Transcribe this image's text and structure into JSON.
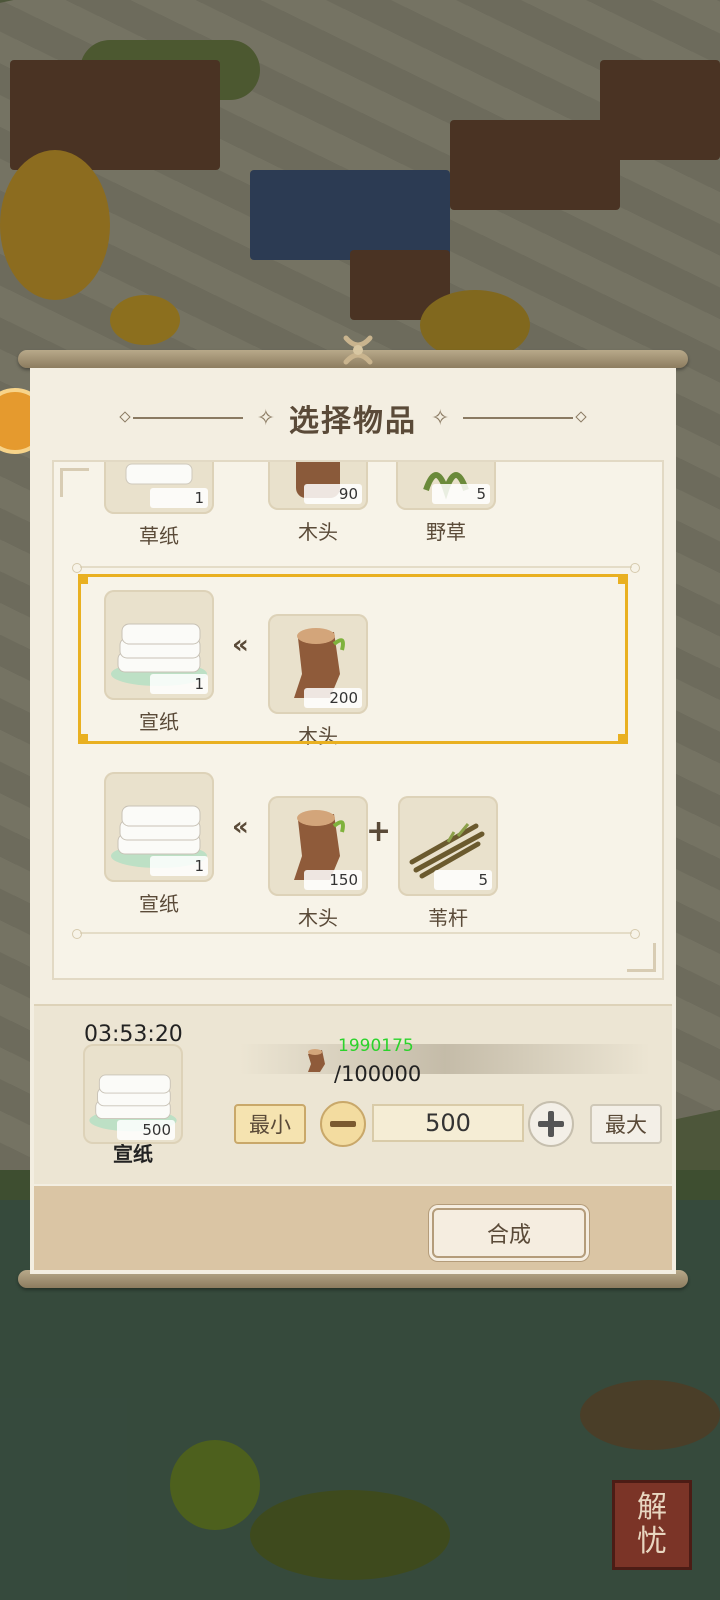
{
  "dialog": {
    "title": "选择物品"
  },
  "recipes": [
    {
      "output": {
        "name": "草纸",
        "count": "1"
      },
      "inputs": [
        {
          "name": "木头",
          "count": "90"
        },
        {
          "name": "野草",
          "count": "5"
        }
      ]
    },
    {
      "selected": true,
      "output": {
        "name": "宣纸",
        "count": "1"
      },
      "inputs": [
        {
          "name": "木头",
          "count": "200"
        }
      ]
    },
    {
      "output": {
        "name": "宣纸",
        "count": "1"
      },
      "inputs": [
        {
          "name": "木头",
          "count": "150"
        },
        {
          "name": "苇杆",
          "count": "5"
        }
      ]
    }
  ],
  "craft": {
    "timer": "03:53:20",
    "product": {
      "name": "宣纸",
      "count": "500"
    },
    "resource": {
      "icon": "wood-log-icon",
      "current": "1990175",
      "max": "/100000"
    },
    "min_label": "最小",
    "max_label": "最大",
    "quantity": "500",
    "craft_label": "合成"
  },
  "scene": {
    "seal_text": [
      "解",
      "忧"
    ]
  },
  "colors": {
    "selected_border": "#e9b021",
    "resource_green": "#2bd32b",
    "panel_bg": "#f3eee1"
  }
}
